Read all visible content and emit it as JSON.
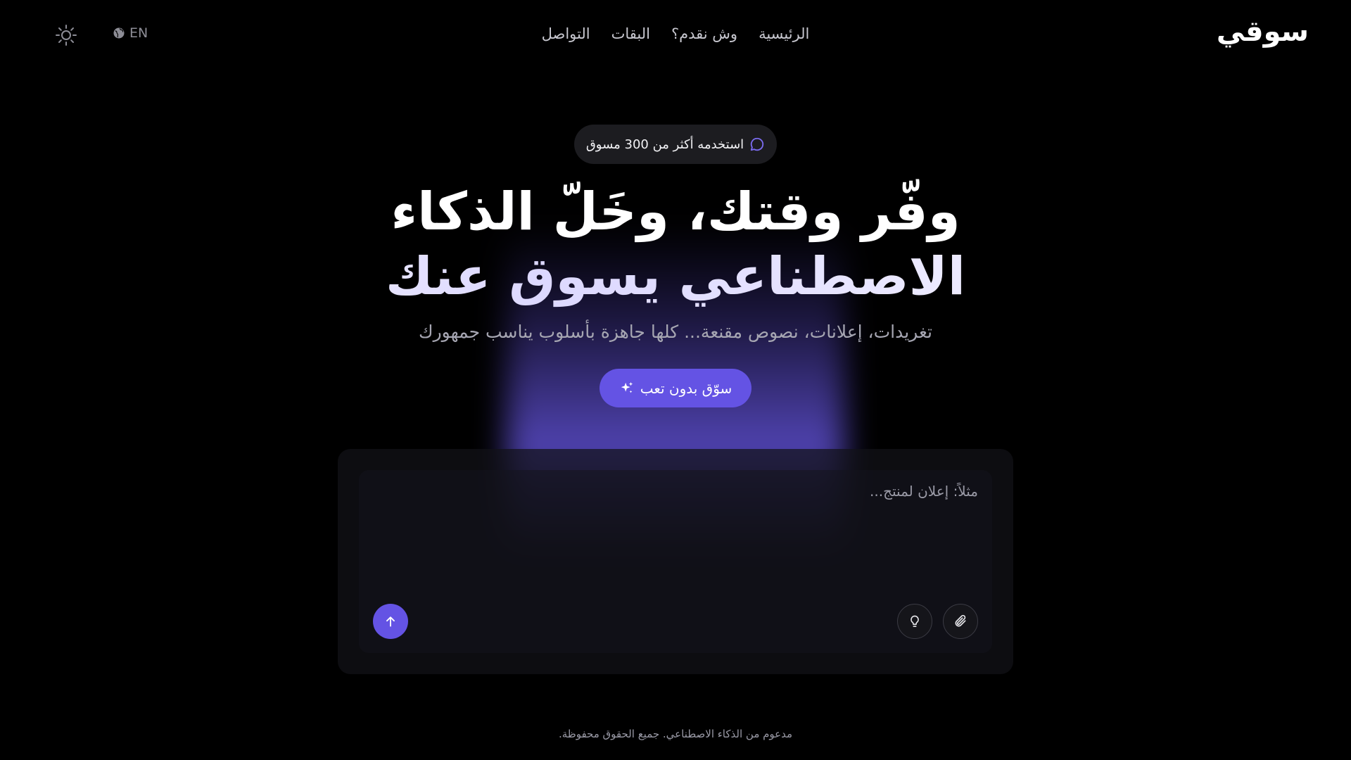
{
  "header": {
    "logo": "سوقي",
    "nav": [
      "الرئيسية",
      "وش نقدم؟",
      "البقات",
      "التواصل"
    ],
    "lang_label": "EN"
  },
  "hero": {
    "badge": "استخدمه أكثر من 300 مسوق",
    "headline_line1": "وفّر وقتك، وخَلّ الذكاء",
    "headline_line2": "الاصطناعي يسوق عنك",
    "subheadline": "تغريدات، إعلانات، نصوص مقنعة... كلها جاهزة بأسلوب يناسب جمهورك",
    "cta_label": "سوّق بدون تعب"
  },
  "composer": {
    "placeholder": "مثلاً: إعلان لمنتج..."
  },
  "footer": {
    "text": "مدعوم من الذكاء الاصطناعي. جميع الحقوق محفوظة."
  },
  "colors": {
    "accent": "#6453e4",
    "background": "#000000"
  },
  "icons": [
    "sun-icon",
    "globe-icon",
    "chat-bubble-icon",
    "sparkles-icon",
    "paperclip-icon",
    "lightbulb-icon",
    "arrow-up-icon"
  ]
}
